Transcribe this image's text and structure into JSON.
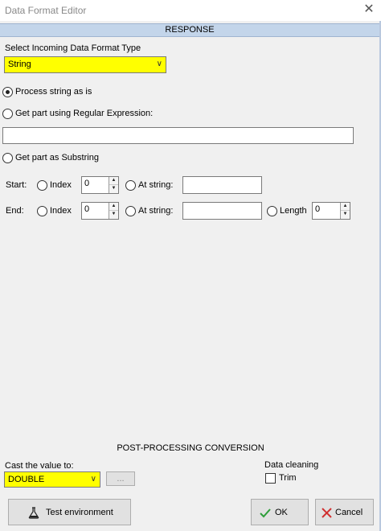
{
  "window": {
    "title": "Data Format Editor",
    "close_glyph": "✕"
  },
  "section_header": "RESPONSE",
  "format_type": {
    "label": "Select Incoming Data Format Type",
    "value": "String",
    "highlight_color": "#ffff00"
  },
  "options": {
    "process_as_is": {
      "label": "Process string as is",
      "checked": true
    },
    "regex": {
      "label": "Get part using Regular Expression:",
      "value": ""
    },
    "substring": {
      "label": "Get part as Substring"
    }
  },
  "start": {
    "label": "Start:",
    "index_label": "Index",
    "index_value": "0",
    "at_string_label": "At string:",
    "at_string_value": ""
  },
  "end": {
    "label": "End:",
    "index_label": "Index",
    "index_value": "0",
    "at_string_label": "At string:",
    "at_string_value": "",
    "length_label": "Length",
    "length_value": "0"
  },
  "post_processing": {
    "title": "POST-PROCESSING CONVERSION",
    "cast_label": "Cast the value to:",
    "cast_value": "DOUBLE",
    "ellipsis_label": "...",
    "cleaning_label": "Data cleaning",
    "trim_label": "Trim"
  },
  "footer": {
    "test_label": "Test environment",
    "ok_label": "OK",
    "cancel_label": "Cancel"
  }
}
